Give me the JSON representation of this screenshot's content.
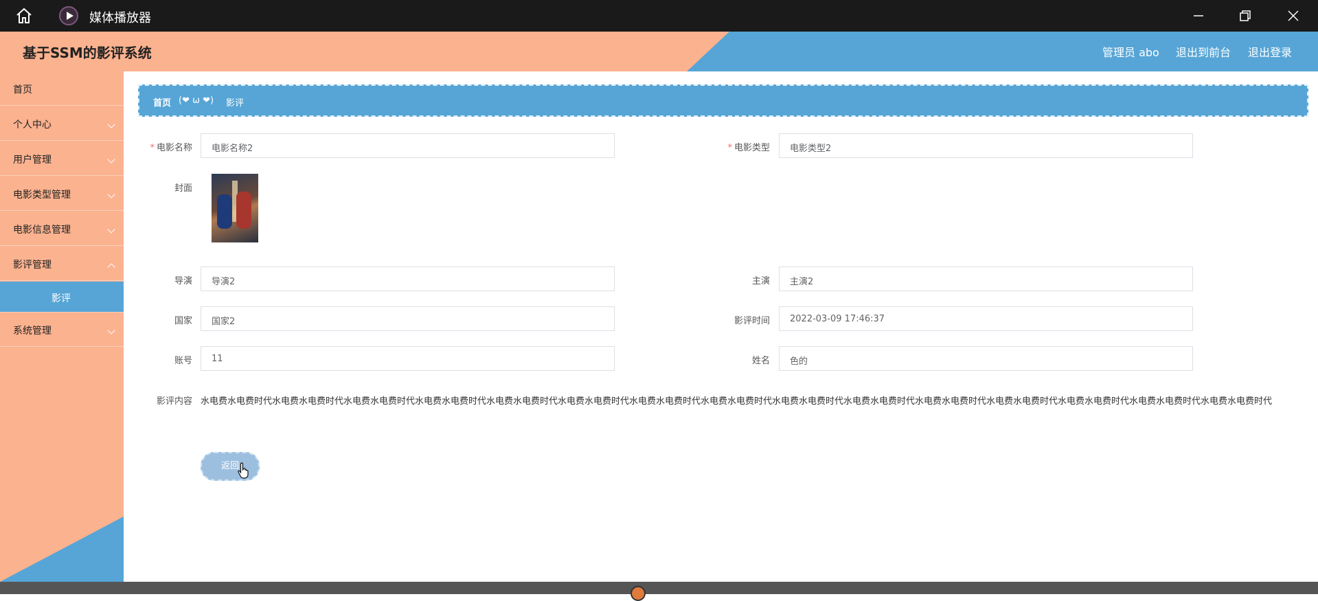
{
  "window": {
    "title": "媒体播放器"
  },
  "header": {
    "system_title": "基于SSM的影评系统",
    "admin": "管理员 abo",
    "to_front": "退出到前台",
    "logout": "退出登录"
  },
  "sidebar": {
    "items": [
      {
        "label": "首页",
        "expandable": false
      },
      {
        "label": "个人中心",
        "expandable": true
      },
      {
        "label": "用户管理",
        "expandable": true
      },
      {
        "label": "电影类型管理",
        "expandable": true
      },
      {
        "label": "电影信息管理",
        "expandable": true
      },
      {
        "label": "影评管理",
        "expandable": true
      },
      {
        "label": "影评",
        "expandable": false,
        "active": true
      },
      {
        "label": "系统管理",
        "expandable": true
      }
    ]
  },
  "breadcrumb": {
    "home": "首页",
    "separator": "(❤ ω ❤)",
    "current": "影评"
  },
  "form": {
    "movie_name": {
      "label": "电影名称",
      "value": "电影名称2",
      "required": true
    },
    "movie_type": {
      "label": "电影类型",
      "value": "电影类型2",
      "required": true
    },
    "cover": {
      "label": "封面"
    },
    "director": {
      "label": "导演",
      "value": "导演2"
    },
    "actor": {
      "label": "主演",
      "value": "主演2"
    },
    "country": {
      "label": "国家",
      "value": "国家2"
    },
    "review_time": {
      "label": "影评时间",
      "value": "2022-03-09 17:46:37"
    },
    "account": {
      "label": "账号",
      "value": "11"
    },
    "name": {
      "label": "姓名",
      "value": "色的"
    },
    "content": {
      "label": "影评内容",
      "value": "水电费水电费时代水电费水电费时代水电费水电费时代水电费水电费时代水电费水电费时代水电费水电费时代水电费水电费时代水电费水电费时代水电费水电费时代水电费水电费时代水电费水电费时代水电费水电费时代水电费水电费时代水电费水电费时代水电费水电费时代"
    },
    "back_button": "返回"
  },
  "colors": {
    "accent_orange": "#fbb28f",
    "accent_blue": "#56a5d6"
  }
}
